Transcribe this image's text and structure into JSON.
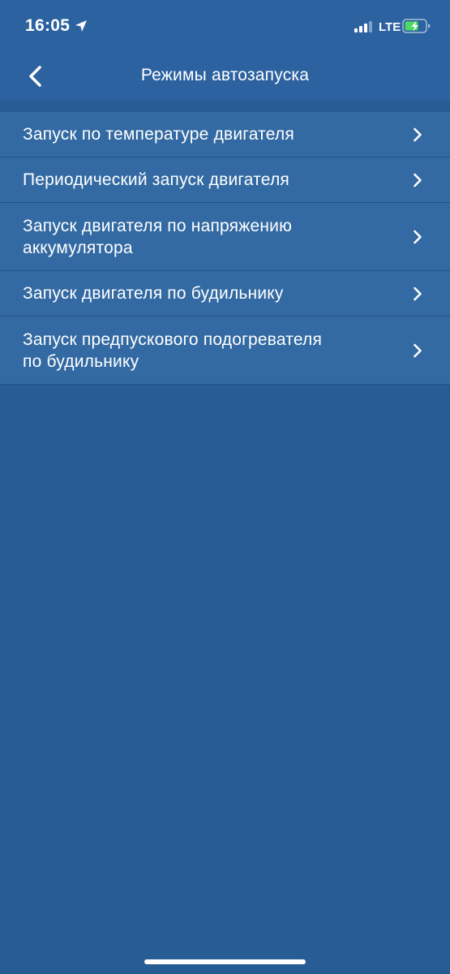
{
  "status_bar": {
    "time": "16:05",
    "network": "LTE",
    "icons": [
      "location-arrow-icon",
      "cellular-signal-icon",
      "battery-charging-icon"
    ]
  },
  "nav": {
    "title": "Режимы автозапуска",
    "back_icon": "chevron-left-icon"
  },
  "list": {
    "items": [
      {
        "label": "Запуск по температуре двигателя",
        "icon": "chevron-right-icon"
      },
      {
        "label": "Периодический запуск двигателя",
        "icon": "chevron-right-icon"
      },
      {
        "label": "Запуск двигателя по напряжению\nаккумулятора",
        "icon": "chevron-right-icon"
      },
      {
        "label": "Запуск двигателя по будильнику",
        "icon": "chevron-right-icon"
      },
      {
        "label": "Запуск предпускового подогревателя\nпо будильнику",
        "icon": "chevron-right-icon"
      }
    ]
  },
  "colors": {
    "background": "#275c95",
    "header": "#2c62a0",
    "list_row": "#336aa3",
    "battery_charge": "#4cd964"
  }
}
